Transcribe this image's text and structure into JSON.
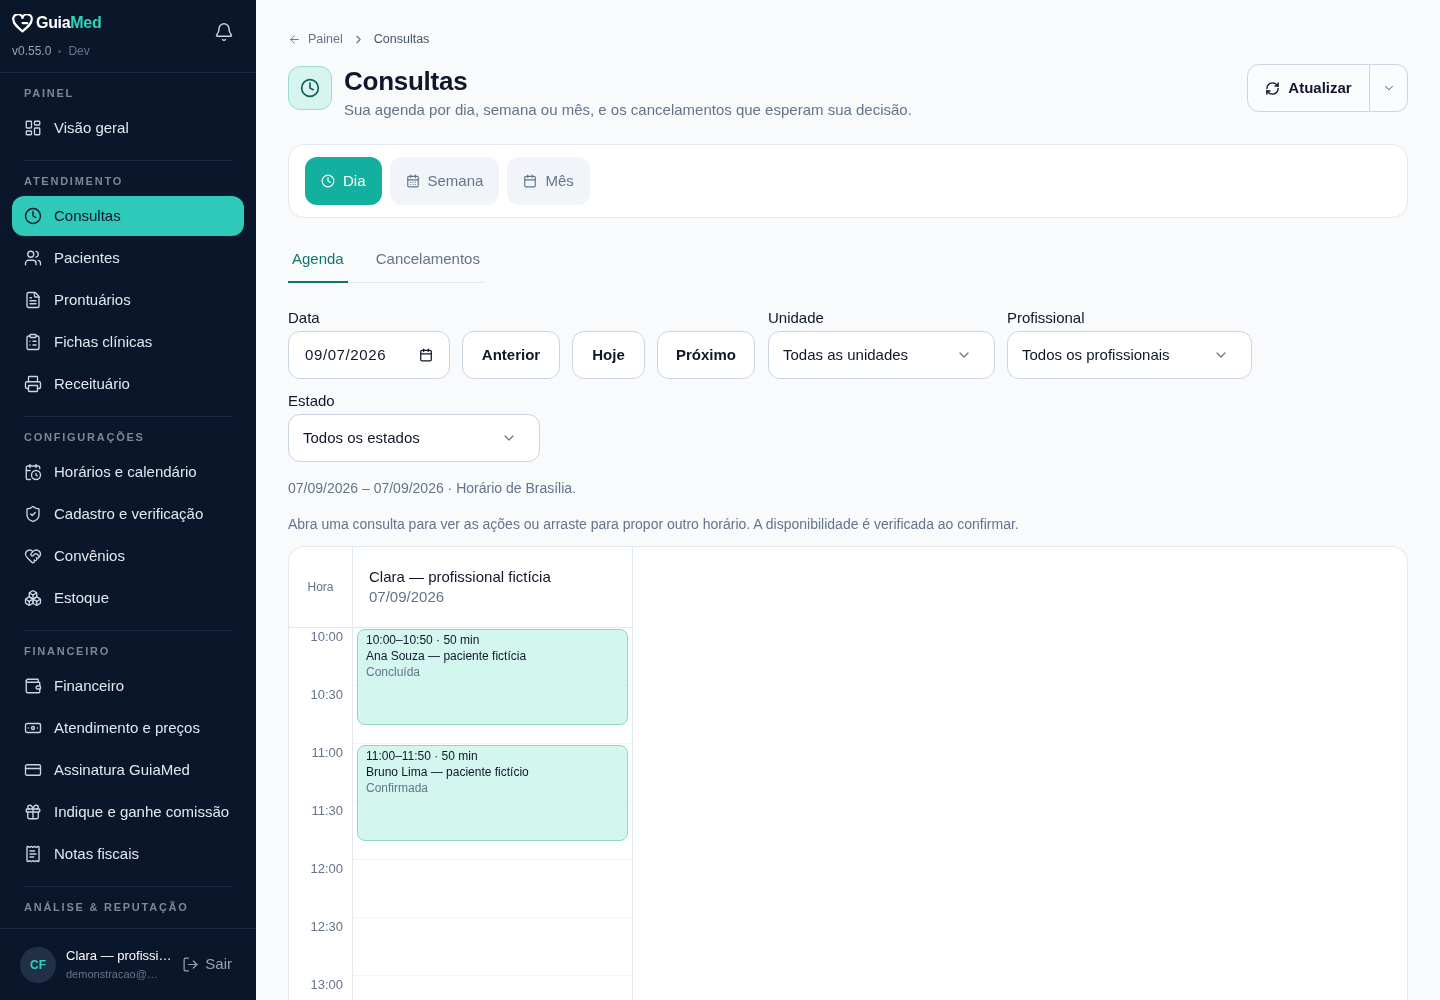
{
  "sidebar": {
    "logo": {
      "text": "Guia",
      "accent": "Med"
    },
    "version": "v0.55.0",
    "environment": "Dev",
    "sections": [
      {
        "heading": "PAINEL",
        "items": [
          {
            "label": "Visão geral",
            "selected": false
          }
        ]
      },
      {
        "heading": "ATENDIMENTO",
        "items": [
          {
            "label": "Consultas",
            "selected": true
          },
          {
            "label": "Pacientes",
            "selected": false
          },
          {
            "label": "Prontuários",
            "selected": false
          },
          {
            "label": "Fichas clínicas",
            "selected": false
          },
          {
            "label": "Receituário",
            "selected": false
          }
        ]
      },
      {
        "heading": "CONFIGURAÇÕES",
        "items": [
          {
            "label": "Horários e calendário",
            "selected": false
          },
          {
            "label": "Cadastro e verificação",
            "selected": false
          },
          {
            "label": "Convênios",
            "selected": false
          },
          {
            "label": "Estoque",
            "selected": false
          }
        ]
      },
      {
        "heading": "FINANCEIRO",
        "items": [
          {
            "label": "Financeiro",
            "selected": false
          },
          {
            "label": "Atendimento e preços",
            "selected": false
          },
          {
            "label": "Assinatura GuiaMed",
            "selected": false
          },
          {
            "label": "Indique e ganhe comissão",
            "selected": false
          },
          {
            "label": "Notas fiscais",
            "selected": false
          }
        ]
      },
      {
        "heading": "ANÁLISE & REPUTAÇÃO"
      }
    ],
    "user": {
      "initials": "CF",
      "name": "Clara — profissi…",
      "email": "demonstracao@…",
      "logout": "Sair"
    }
  },
  "breadcrumb": {
    "back": "Painel",
    "current": "Consultas"
  },
  "header": {
    "title": "Consultas",
    "subtitle": "Sua agenda por dia, semana ou mês, e os cancelamentos que esperam sua decisão.",
    "refresh": "Atualizar"
  },
  "view_modes": [
    {
      "label": "Dia",
      "selected": true
    },
    {
      "label": "Semana",
      "selected": false
    },
    {
      "label": "Mês",
      "selected": false
    }
  ],
  "tabs": [
    {
      "label": "Agenda",
      "selected": true
    },
    {
      "label": "Cancelamentos",
      "selected": false
    }
  ],
  "filters": {
    "date": {
      "label": "Data",
      "value": "09/07/2026"
    },
    "nav_buttons": [
      "Anterior",
      "Hoje",
      "Próximo"
    ],
    "unit": {
      "label": "Unidade",
      "value": "Todas as unidades"
    },
    "professional": {
      "label": "Profissional",
      "value": "Todos os profissionais"
    },
    "status": {
      "label": "Estado",
      "value": "Todos os estados"
    }
  },
  "range_note": "07/09/2026 – 07/09/2026 · Horário de Brasília.",
  "hint": "Abra uma consulta para ver as ações ou arraste para propor outro horário. A disponibilidade é verificada ao confirmar.",
  "calendar": {
    "hour_heading": "Hora",
    "column": {
      "name": "Clara — profissional fictícia",
      "date": "07/09/2026"
    },
    "slots": [
      {
        "time": "10:00",
        "events": [
          {
            "time_range": "10:00–10:50 · 50 min",
            "patient": "Ana Souza — paciente fictícia",
            "status": "Concluída"
          }
        ]
      },
      {
        "time": "10:30"
      },
      {
        "time": "11:00",
        "events": [
          {
            "time_range": "11:00–11:50 · 50 min",
            "patient": "Bruno Lima — paciente fictício",
            "status": "Confirmada"
          }
        ]
      },
      {
        "time": "11:30"
      },
      {
        "time": "12:00"
      },
      {
        "time": "12:30"
      },
      {
        "time": "13:00"
      }
    ]
  }
}
